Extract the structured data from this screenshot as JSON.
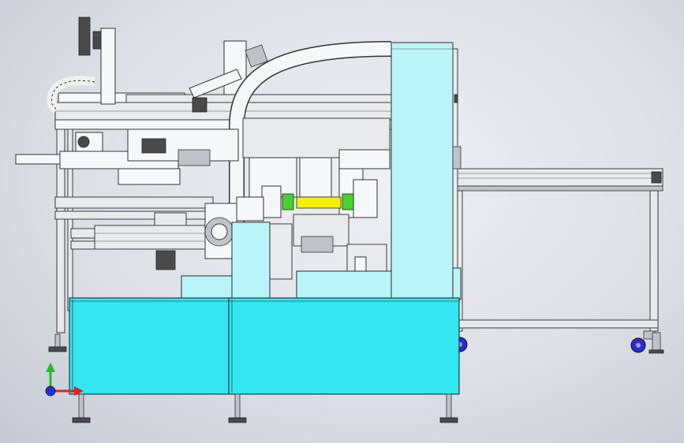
{
  "scene": {
    "colors": {
      "background": "#d3d7de",
      "cabinet": "#33e6f0",
      "guard_panel": "#b9f5f8",
      "frame": "#e8eaec",
      "yellow_part": "#f4f000",
      "green_part": "#48d42a",
      "caster": "#2b2bd0"
    }
  },
  "triad": {
    "icon": "xyz-axis-triad",
    "x_color": "#e52020",
    "y_color": "#20c020",
    "origin_color": "#2030e0"
  }
}
